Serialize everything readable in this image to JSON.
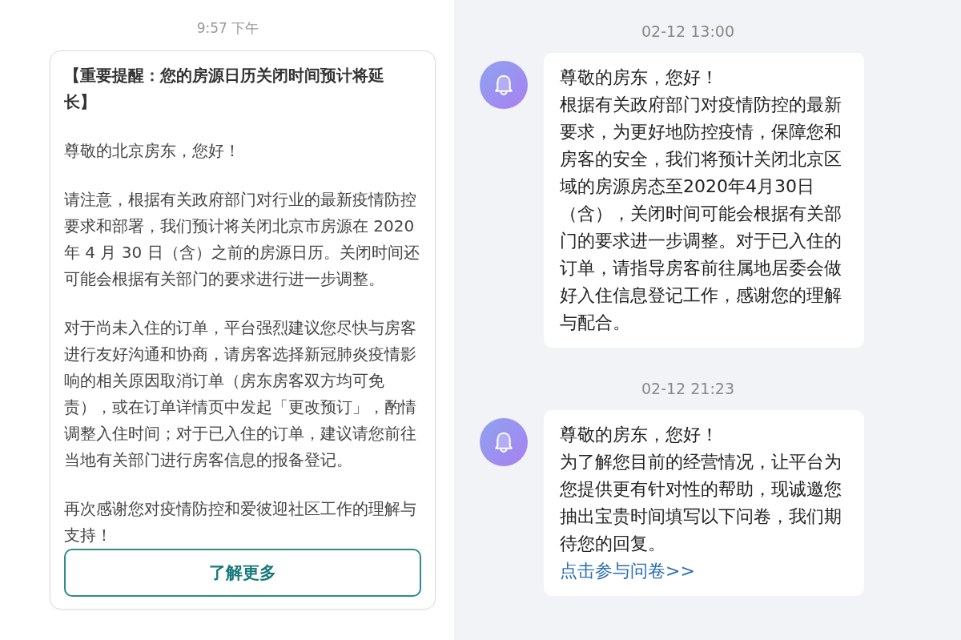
{
  "left_panel": {
    "timestamp": "9:57 下午",
    "card": {
      "title": "【重要提醒：您的房源日历关闭时间预计将延长】",
      "paragraphs": [
        "尊敬的北京房东，您好！",
        "请注意，根据有关政府部门对行业的最新疫情防控要求和部署，我们预计将关闭北京市房源在 2020 年 4 月 30 日（含）之前的房源日历。关闭时间还可能会根据有关部门的要求进行进一步调整。",
        "对于尚未入住的订单，平台强烈建议您尽快与房客进行友好沟通和协商，请房客选择新冠肺炎疫情影响的相关原因取消订单（房东房客双方均可免责），或在订单详情页中发起「更改预订」，酌情调整入住时间；对于已入住的订单，建议请您前往当地有关部门进行房客信息的报备登记。",
        "再次感谢您对疫情防控和爱彼迎社区工作的理解与支持！"
      ],
      "button": "了解更多"
    }
  },
  "right_panel": {
    "messages": [
      {
        "timestamp": "02-12 13:00",
        "lines": [
          "尊敬的房东，您好！",
          "根据有关政府部门对疫情防控的最新要求，为更好地防控疫情，保障您和房客的安全，我们将预计关闭北京区域的房源房态至2020年4月30日（含），关闭时间可能会根据有关部门的要求进一步调整。对于已入住的订单，请指导房客前往属地居委会做好入住信息登记工作，感谢您的理解与配合。"
        ]
      },
      {
        "timestamp": "02-12 21:23",
        "lines": [
          "尊敬的房东，您好！",
          "为了解您目前的经营情况，让平台为您提供更有针对性的帮助，现诚邀您抽出宝贵时间填写以下问卷，我们期待您的回复。"
        ],
        "link": "点击参与问卷>>"
      }
    ]
  }
}
